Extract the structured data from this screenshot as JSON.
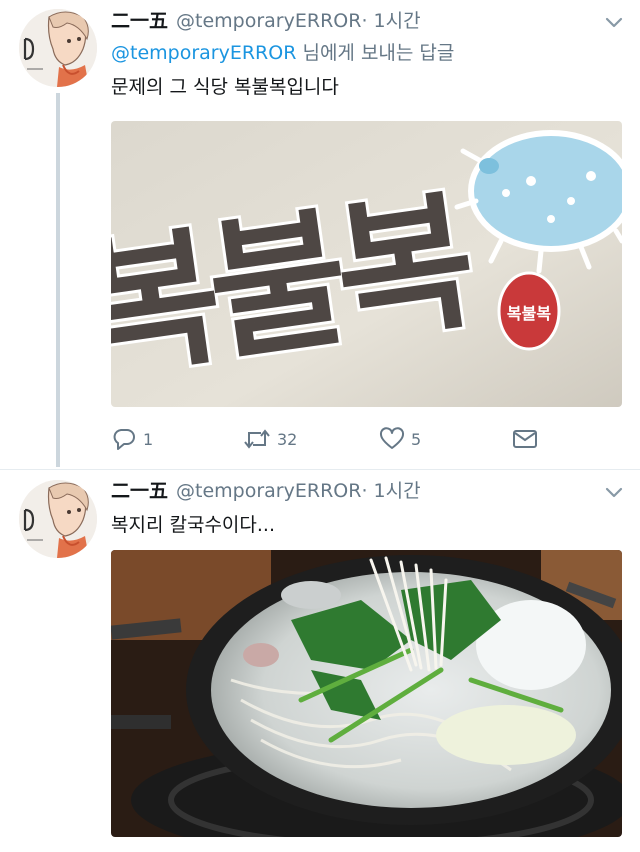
{
  "tweets": [
    {
      "name": "二一五",
      "handle": "@temporaryERROR",
      "time": "· 1시간",
      "reply_to": {
        "mention": "@temporaryERROR",
        "suffix": " 님에게 보내는 답글"
      },
      "text": "문제의 그 식당 복불복입니다",
      "media": {
        "sign_text": "복불복",
        "stamp_text": "복불복"
      },
      "actions": {
        "reply": "1",
        "retweet": "32",
        "like": "5"
      }
    },
    {
      "name": "二一五",
      "handle": "@temporaryERROR",
      "time": "· 1시간",
      "text": "복지리 칼국수이다..."
    }
  ],
  "colors": {
    "accent": "#1b95e0",
    "secondary": "#657786",
    "line": "#ccd6dd"
  },
  "icons": [
    "avatar-illustration",
    "chevron-down-icon",
    "reply-icon",
    "retweet-icon",
    "like-icon",
    "message-icon",
    "pufferfish-icon"
  ]
}
